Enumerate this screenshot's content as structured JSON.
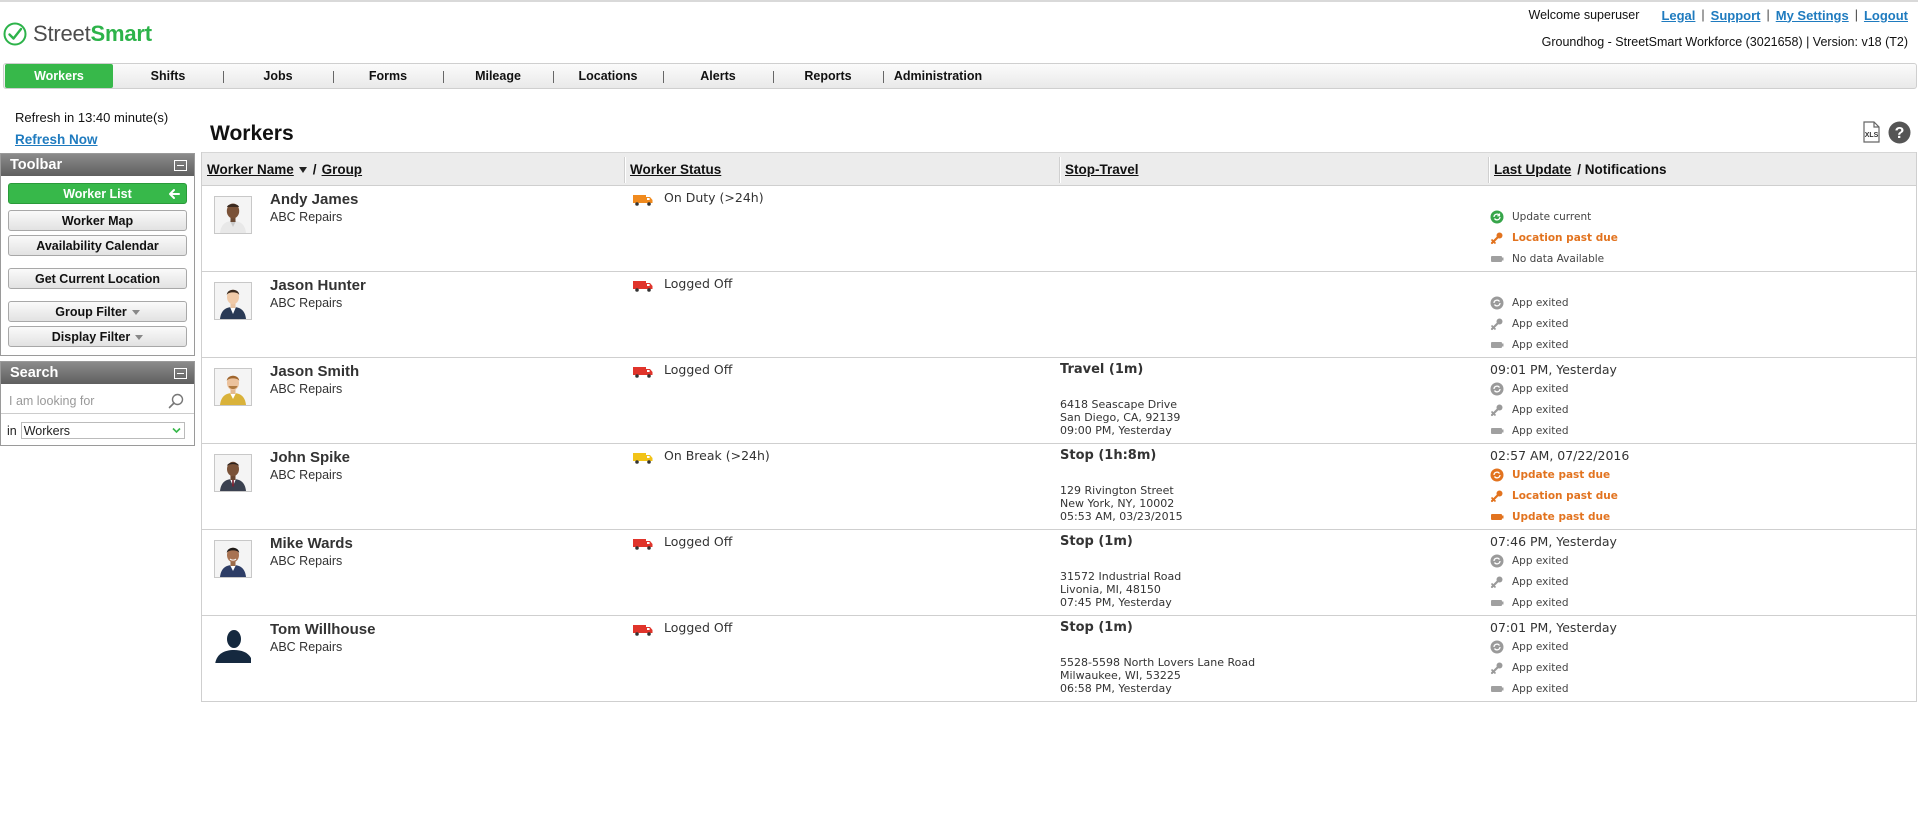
{
  "app": {
    "logo_street": "Street",
    "logo_smart": "Smart",
    "welcome": "Welcome superuser",
    "links": {
      "legal": "Legal",
      "support": "Support",
      "settings": "My Settings",
      "logout": "Logout"
    },
    "tenant": "Groundhog - StreetSmart Workforce (3021658)  |  Version: v18 (T2)"
  },
  "nav": {
    "items": [
      "Workers",
      "Shifts",
      "Jobs",
      "Forms",
      "Mileage",
      "Locations",
      "Alerts",
      "Reports",
      "Administration"
    ],
    "active": "Workers"
  },
  "sidebar": {
    "refresh_text": "Refresh in 13:40 minute(s)",
    "refresh_link": "Refresh Now",
    "toolbar_title": "Toolbar",
    "buttons": {
      "worker_list": "Worker List",
      "worker_map": "Worker Map",
      "availability": "Availability Calendar",
      "current_location": "Get Current Location",
      "group_filter": "Group Filter",
      "display_filter": "Display Filter"
    },
    "search_title": "Search",
    "search_placeholder": "I am looking for",
    "in_label": "in",
    "in_value": "Workers"
  },
  "main": {
    "title": "Workers",
    "columns": {
      "worker_name": "Worker Name",
      "slash1": "/",
      "group": "Group",
      "worker_status": "Worker Status",
      "stop_travel": "Stop-Travel",
      "last_update": "Last Update",
      "notifications": "/ Notifications"
    }
  },
  "workers": [
    {
      "name": "Andy James",
      "group": "ABC Repairs",
      "status": "On Duty  (>24h)",
      "truck_color": "orange",
      "stop": {
        "title": "",
        "line1": "",
        "line2": "",
        "line3": ""
      },
      "last_update": "",
      "notifications": [
        {
          "icon": "update-icon",
          "text": "Update current",
          "color": "green"
        },
        {
          "icon": "location-icon",
          "text": "Location past due",
          "color": "orange"
        },
        {
          "icon": "battery-icon",
          "text": "No data Available",
          "color": "gray"
        }
      ]
    },
    {
      "name": "Jason Hunter",
      "group": "ABC Repairs",
      "status": "Logged Off",
      "truck_color": "red",
      "stop": {
        "title": "",
        "line1": "",
        "line2": "",
        "line3": ""
      },
      "last_update": "",
      "notifications": [
        {
          "icon": "update-icon",
          "text": "App exited",
          "color": "gray"
        },
        {
          "icon": "location-icon",
          "text": "App exited",
          "color": "gray"
        },
        {
          "icon": "battery-icon",
          "text": "App exited",
          "color": "gray"
        }
      ]
    },
    {
      "name": "Jason Smith",
      "group": "ABC Repairs",
      "status": "Logged Off",
      "truck_color": "red",
      "stop": {
        "title": "Travel  (1m)",
        "line1": "6418 Seascape Drive",
        "line2": "San Diego, CA, 92139",
        "line3": "09:00 PM, Yesterday"
      },
      "last_update": "09:01 PM, Yesterday",
      "notifications": [
        {
          "icon": "update-icon",
          "text": "App exited",
          "color": "gray"
        },
        {
          "icon": "location-icon",
          "text": "App exited",
          "color": "gray"
        },
        {
          "icon": "battery-icon",
          "text": "App exited",
          "color": "gray"
        }
      ]
    },
    {
      "name": "John Spike",
      "group": "ABC Repairs",
      "status": "On Break  (>24h)",
      "truck_color": "yellow",
      "stop": {
        "title": "Stop  (1h:8m)",
        "line1": "129 Rivington Street",
        "line2": "New York, NY, 10002",
        "line3": "05:53 AM, 03/23/2015"
      },
      "last_update": "02:57 AM, 07/22/2016",
      "notifications": [
        {
          "icon": "update-icon",
          "text": "Update past due",
          "color": "orange"
        },
        {
          "icon": "location-icon",
          "text": "Location past due",
          "color": "orange"
        },
        {
          "icon": "battery-icon",
          "text": "Update past due",
          "color": "orange"
        }
      ]
    },
    {
      "name": "Mike Wards",
      "group": "ABC Repairs",
      "status": "Logged Off",
      "truck_color": "red",
      "stop": {
        "title": "Stop  (1m)",
        "line1": "31572 Industrial Road",
        "line2": "Livonia, MI, 48150",
        "line3": "07:45 PM, Yesterday"
      },
      "last_update": "07:46 PM, Yesterday",
      "notifications": [
        {
          "icon": "update-icon",
          "text": "App exited",
          "color": "gray"
        },
        {
          "icon": "location-icon",
          "text": "App exited",
          "color": "gray"
        },
        {
          "icon": "battery-icon",
          "text": "App exited",
          "color": "gray"
        }
      ]
    },
    {
      "name": "Tom Willhouse",
      "group": "ABC Repairs",
      "status": "Logged Off",
      "truck_color": "red",
      "stop": {
        "title": "Stop  (1m)",
        "line1": "5528-5598 North Lovers Lane Road",
        "line2": "Milwaukee, WI, 53225",
        "line3": "06:58 PM, Yesterday"
      },
      "last_update": "07:01 PM, Yesterday",
      "notifications": [
        {
          "icon": "update-icon",
          "text": "App exited",
          "color": "gray"
        },
        {
          "icon": "location-icon",
          "text": "App exited",
          "color": "gray"
        },
        {
          "icon": "battery-icon",
          "text": "App exited",
          "color": "gray"
        }
      ]
    }
  ],
  "colors": {
    "accent_green": "#37b84a",
    "link_blue": "#1f7bbf",
    "warn_orange": "#e2731f",
    "truck_red": "#e0342b",
    "truck_orange": "#f08a1e",
    "truck_yellow": "#f2c318",
    "icon_gray": "#9a9a9a"
  }
}
